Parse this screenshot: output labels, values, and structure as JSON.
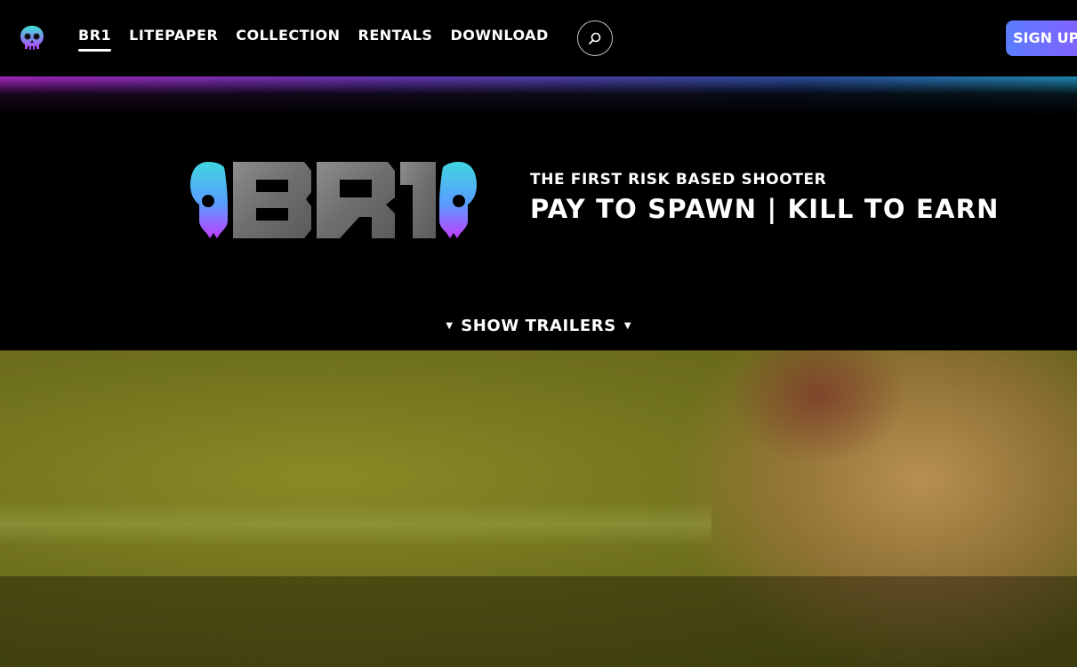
{
  "nav": {
    "logo_icon": "skull-icon",
    "links": [
      {
        "label": "BR1",
        "active": true
      },
      {
        "label": "LITEPAPER",
        "active": false
      },
      {
        "label": "COLLECTION",
        "active": false
      },
      {
        "label": "RENTALS",
        "active": false
      },
      {
        "label": "DOWNLOAD",
        "active": false
      }
    ],
    "search_icon": "search-icon",
    "signup_label": "SIGN UP"
  },
  "hero": {
    "logo_text": "BR1",
    "subtitle": "THE FIRST RISK BASED SHOOTER",
    "title": "PAY TO SPAWN | KILL TO EARN",
    "trailers_label": "SHOW TRAILERS",
    "trailers_arrow": "▼"
  },
  "colors": {
    "accent_gradient_start": "#5a7dff",
    "accent_gradient_end": "#8a5cff",
    "skull_cyan": "#3fd6e0",
    "skull_magenta": "#c03cff"
  }
}
